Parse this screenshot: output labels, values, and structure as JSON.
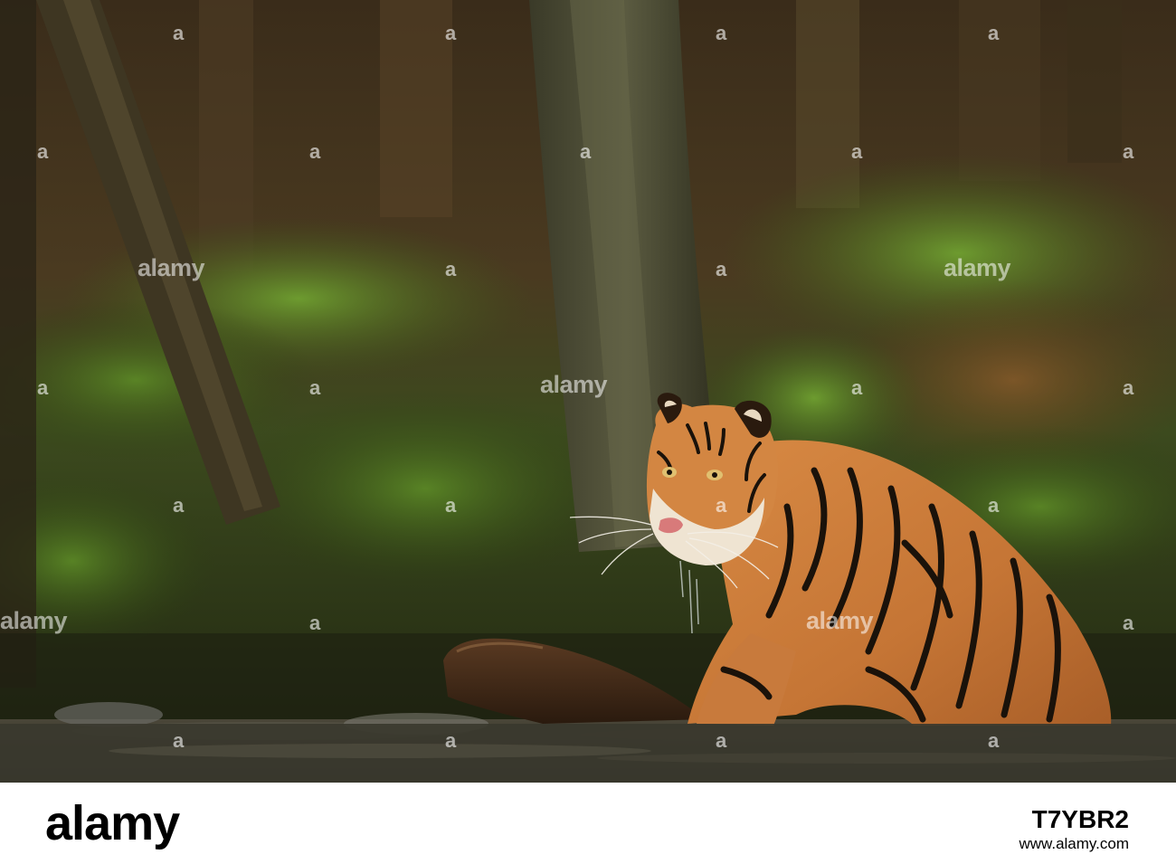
{
  "photo": {
    "subject": "tiger-in-forest-stream",
    "colors": {
      "forest_dark": "#2a2418",
      "moss": "#5d8a2a",
      "tiger_orange": "#c9783a",
      "water": "#3b3a34"
    }
  },
  "watermark": {
    "word": "alamy",
    "dot": "a"
  },
  "footer": {
    "brand": "alamy",
    "image_id": "T7YBR2",
    "url": "www.alamy.com"
  }
}
